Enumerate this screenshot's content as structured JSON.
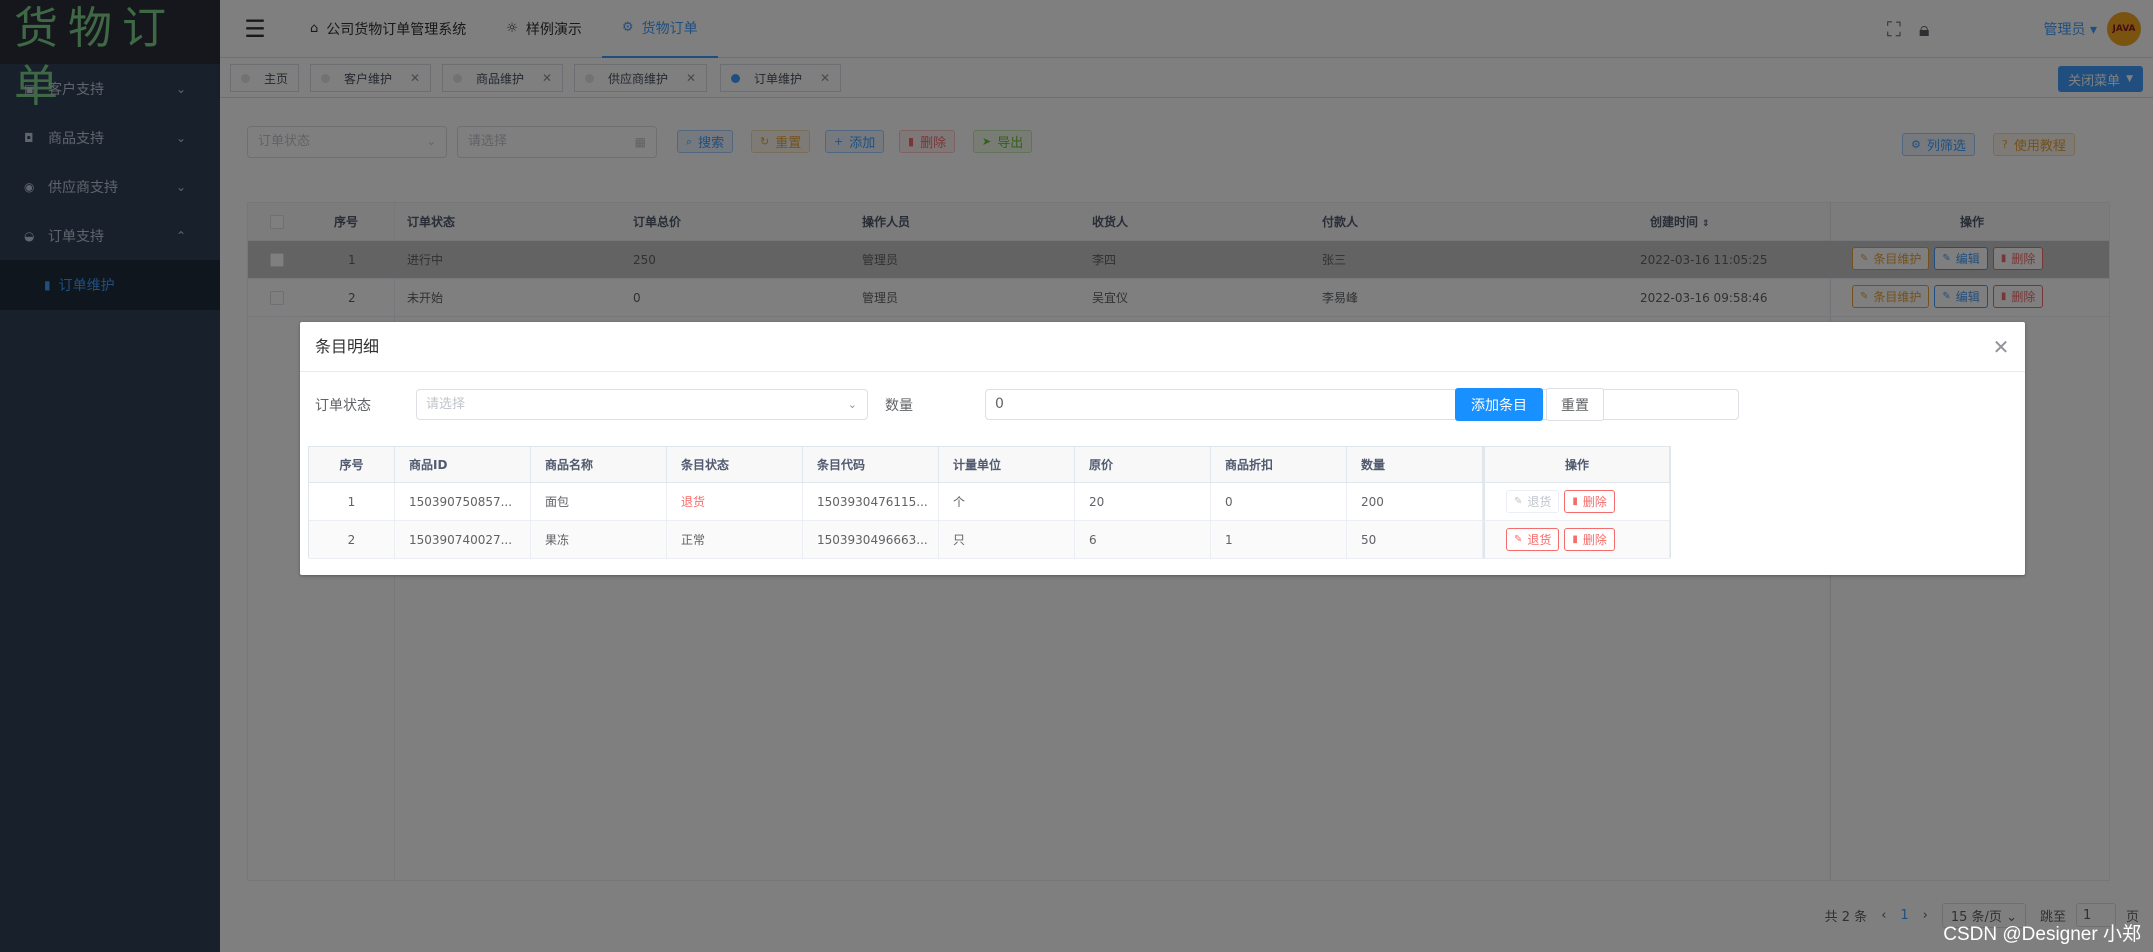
{
  "app": {
    "logo": "货物订单",
    "watermark": "CSDN @Designer 小郑"
  },
  "sidebar": {
    "items": [
      {
        "label": "客户支持",
        "icon": "address-card-icon"
      },
      {
        "label": "商品支持",
        "icon": "shopping-bag-icon"
      },
      {
        "label": "供应商支持",
        "icon": "supplier-icon"
      },
      {
        "label": "订单支持",
        "icon": "order-icon"
      }
    ],
    "active_sub": "订单维护"
  },
  "topnav": {
    "items": [
      "公司货物订单管理系统",
      "样例演示",
      "货物订单"
    ],
    "active": "货物订单",
    "user": "管理员",
    "avatar_text": "JAVA"
  },
  "tags": {
    "items": [
      "主页",
      "客户维护",
      "商品维护",
      "供应商维护",
      "订单维护"
    ],
    "active": "订单维护",
    "close_menu": "关闭菜单"
  },
  "toolbar": {
    "status_placeholder": "订单状态",
    "date_placeholder": "请选择",
    "search": "搜索",
    "reset": "重置",
    "add": "添加",
    "delete": "删除",
    "export": "导出",
    "column_filter": "列筛选",
    "tutorial": "使用教程"
  },
  "orders": {
    "headers": [
      "序号",
      "订单状态",
      "订单总价",
      "操作人员",
      "收货人",
      "付款人",
      "创建时间",
      "操作"
    ],
    "rows": [
      {
        "no": "1",
        "status": "进行中",
        "total": "250",
        "operator": "管理员",
        "receiver": "李四",
        "payer": "张三",
        "created": "2022-03-16 11:05:25"
      },
      {
        "no": "2",
        "status": "未开始",
        "total": "0",
        "operator": "管理员",
        "receiver": "吴宜仪",
        "payer": "李易峰",
        "created": "2022-03-16 09:58:46"
      }
    ],
    "ops": {
      "items": "条目维护",
      "edit": "编辑",
      "delete": "删除"
    }
  },
  "pagination": {
    "total": "共 2 条",
    "current": "1",
    "page_size": "15 条/页",
    "jump_label": "跳至",
    "jump_value": "1",
    "page_unit": "页"
  },
  "dialog": {
    "title": "条目明细",
    "status_label": "订单状态",
    "status_placeholder": "请选择",
    "qty_label": "数量",
    "qty_value": "0",
    "add_button": "添加条目",
    "reset_button": "重置",
    "table": {
      "headers": [
        "序号",
        "商品ID",
        "商品名称",
        "条目状态",
        "条目代码",
        "计量单位",
        "原价",
        "商品折扣",
        "数量",
        "操作"
      ],
      "rows": [
        {
          "no": "1",
          "product_id": "150390750857...",
          "name": "面包",
          "status": "退货",
          "code": "1503930476115...",
          "unit": "个",
          "price": "20",
          "discount": "0",
          "qty": "200"
        },
        {
          "no": "2",
          "product_id": "150390740027...",
          "name": "果冻",
          "status": "正常",
          "code": "1503930496663...",
          "unit": "只",
          "price": "6",
          "discount": "1",
          "qty": "50"
        }
      ],
      "ops": {
        "return": "退货",
        "delete": "删除"
      }
    }
  },
  "colors": {
    "primary": "#1890ff",
    "danger": "#f56c6c",
    "warning": "#e6a23c",
    "sidebar_bg": "#304156"
  }
}
